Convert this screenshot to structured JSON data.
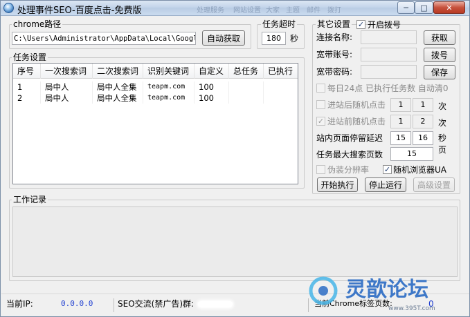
{
  "window": {
    "title": "处理事件SEO-百度点击-免费版",
    "ghost_title": [
      "处理服务",
      "网站设置",
      "大家",
      "主题",
      "邮件",
      "拨打"
    ]
  },
  "chrome": {
    "group_label": "chrome路径",
    "path": "C:\\Users\\Administrator\\AppData\\Local\\Google\\",
    "auto_get_label": "自动获取"
  },
  "timeout": {
    "group_label": "任务超时",
    "value": "180",
    "unit": "秒"
  },
  "tasks": {
    "group_label": "任务设置",
    "columns": [
      "序号",
      "一次搜索词",
      "二次搜索词",
      "识别关键词",
      "自定义",
      "总任务",
      "已执行"
    ],
    "rows": [
      [
        "1",
        "局中人",
        "局中人全集",
        "teapm.com",
        "100",
        "",
        ""
      ],
      [
        "2",
        "局中人",
        "局中人全集",
        "teapm.com",
        "100",
        "",
        ""
      ]
    ]
  },
  "other": {
    "group_label": "其它设置",
    "dialup_label": "开启拨号",
    "conn_name_label": "连接名称:",
    "account_label": "宽带账号:",
    "password_label": "宽带密码:",
    "get_label": "获取",
    "dial_label": "拨号",
    "save_label": "保存",
    "daily_reset_label": "每日24点  已执行任务数  自动清0",
    "after_random_label": "进站后随机点击",
    "after_min": "1",
    "after_max": "1",
    "after_unit": "次",
    "before_random_label": "进站前随机点击",
    "before_min": "1",
    "before_max": "2",
    "before_unit": "次",
    "dwell_label": "站内页面停留延迟",
    "dwell_min": "15",
    "dwell_max": "16",
    "dwell_unit": "秒",
    "max_pages_label": "任务最大搜索页数",
    "max_pages": "15",
    "pages_unit": "页",
    "fake_res_label": "伪装分辨率",
    "random_ua_label": "随机浏览器UA",
    "start_label": "开始执行",
    "stop_label": "停止运行",
    "advanced_label": "高级设置"
  },
  "log": {
    "group_label": "工作记录"
  },
  "status": {
    "ip_label": "当前IP:",
    "ip_value": "0.0.0.0",
    "group_label": "SEO交流(禁广告)群:",
    "tab_label": "当前Chrome标签页数:",
    "tab_value": "0"
  },
  "watermark": {
    "brand": "灵歆论坛",
    "url": "www.395T.com"
  },
  "colors": {
    "ip_value": "#1f3fd1",
    "watermark_blue": "#2b6cc4",
    "watermark_cyan": "#46b5e8"
  }
}
